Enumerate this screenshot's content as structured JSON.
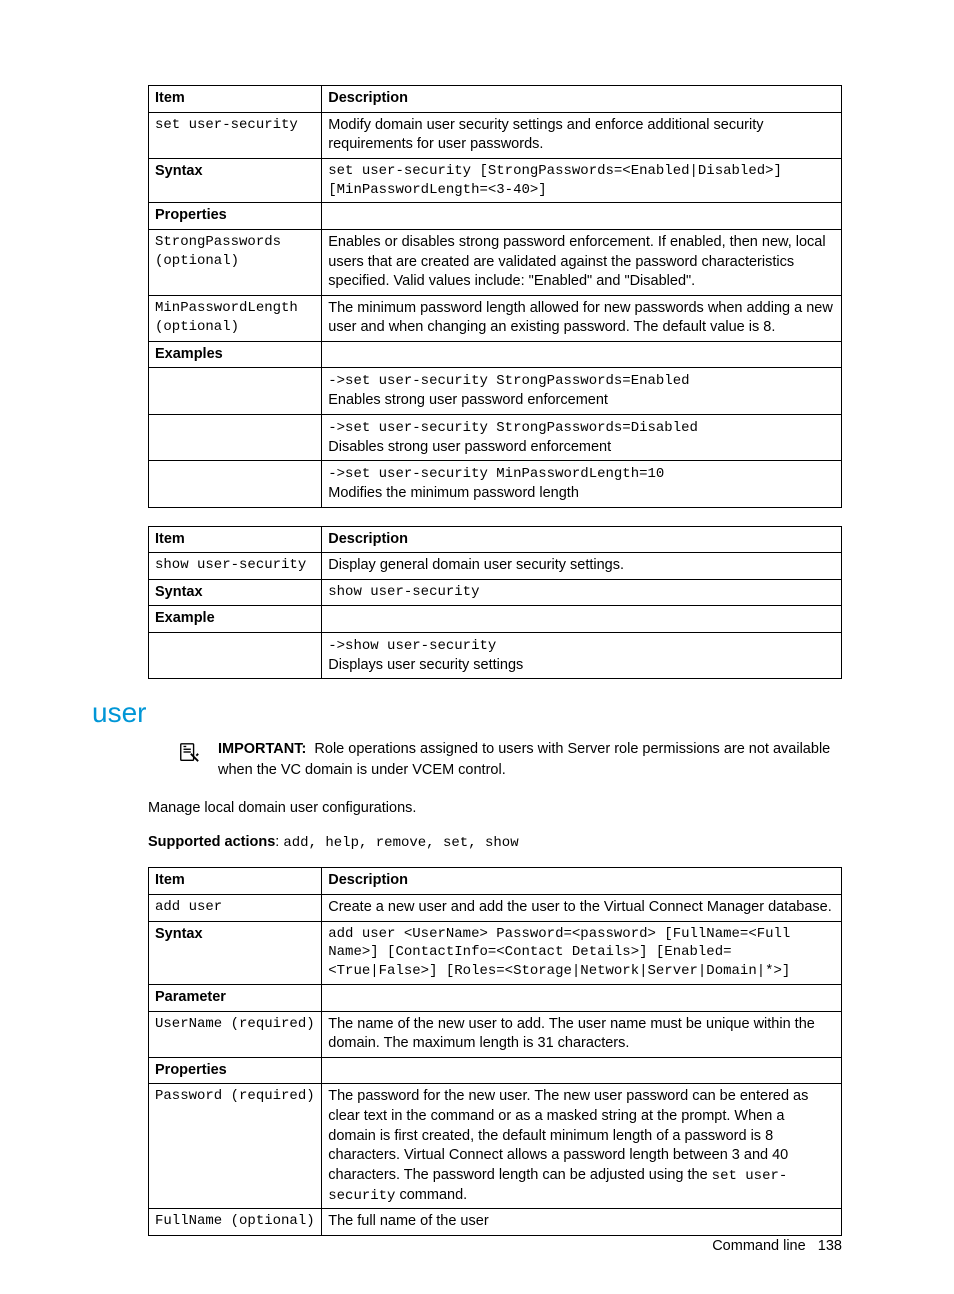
{
  "table1": {
    "headers": [
      "Item",
      "Description"
    ],
    "rows": [
      {
        "c1_mono": "set user-security",
        "c2": "Modify domain user security settings and enforce additional security requirements for user passwords."
      },
      {
        "c1_bold": "Syntax",
        "c2_mono": "set user-security [StrongPasswords=<Enabled|Disabled>] [MinPasswordLength=<3-40>]"
      },
      {
        "c1_bold": "Properties",
        "c2": ""
      },
      {
        "c1_mono": "StrongPasswords (optional)",
        "c2": "Enables or disables strong password enforcement. If enabled, then new, local users that are created are validated against the password characteristics specified. Valid values include: \"Enabled\" and \"Disabled\"."
      },
      {
        "c1_mono": "MinPasswordLength (optional)",
        "c2": "The minimum password length allowed for new passwords when adding a new user and when changing an existing password. The default value is 8."
      },
      {
        "c1_bold": "Examples",
        "c2": ""
      },
      {
        "c1": "",
        "c2_mixed": {
          "mono": "->set user-security StrongPasswords=Enabled",
          "text": "Enables strong user password enforcement"
        }
      },
      {
        "c1": "",
        "c2_mixed": {
          "mono": "->set user-security StrongPasswords=Disabled",
          "text": "Disables strong user password enforcement"
        }
      },
      {
        "c1": "",
        "c2_mixed": {
          "mono": "->set user-security MinPasswordLength=10",
          "text": "Modifies the minimum password length"
        }
      }
    ]
  },
  "table2": {
    "headers": [
      "Item",
      "Description"
    ],
    "rows": [
      {
        "c1_mono": "show user-security",
        "c2": "Display general domain user security settings."
      },
      {
        "c1_bold": "Syntax",
        "c2_mono": "show user-security"
      },
      {
        "c1_bold": "Example",
        "c2": ""
      },
      {
        "c1": "",
        "c2_mixed": {
          "mono": "->show user-security",
          "text": "Displays user security settings"
        }
      }
    ]
  },
  "section_heading": "user",
  "important_label": "IMPORTANT:",
  "important_text": "Role operations assigned to users with Server role permissions are not available when the VC domain is under VCEM control.",
  "body1": "Manage local domain user configurations.",
  "supported_label": "Supported actions",
  "supported_colon": ": ",
  "supported_actions": "add, help, remove, set, show",
  "table3": {
    "headers": [
      "Item",
      "Description"
    ],
    "rows": [
      {
        "c1_mono": "add user",
        "c2": "Create a new user and add the user to the Virtual Connect Manager database."
      },
      {
        "c1_bold": "Syntax",
        "c2_mono": "add user <UserName> Password=<password> [FullName=<Full Name>] [ContactInfo=<Contact Details>] [Enabled=<True|False>] [Roles=<Storage|Network|Server|Domain|*>]"
      },
      {
        "c1_bold": "Parameter",
        "c2": ""
      },
      {
        "c1_mono": "UserName (required)",
        "c2": "The name of the new user to add. The user name must be unique within the domain. The maximum length is 31 characters."
      },
      {
        "c1_bold": "Properties",
        "c2": ""
      },
      {
        "c1_mono": "Password (required)",
        "c2_pwd": {
          "pre": "The password for the new user. The new user password can be entered as clear text in the command or as a masked string at the prompt. When a domain is first created, the default minimum length of a password is 8 characters. Virtual Connect allows a password length between 3 and 40 characters. The password length can be adjusted using the ",
          "mono": "set user-security",
          "post": " command."
        }
      },
      {
        "c1_mono": "FullName (optional)",
        "c2": "The full name of the user"
      }
    ]
  },
  "footer_label": "Command line",
  "footer_page": "138"
}
